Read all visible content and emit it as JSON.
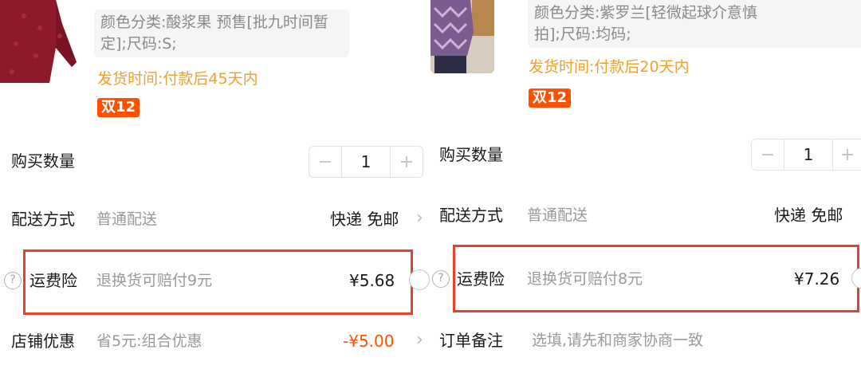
{
  "left": {
    "variant_line1": "颜色分类:酸浆果 预售[批九时间暂",
    "variant_line2": "定];尺码:S;",
    "ship_time": "发货时间:付款后45天内",
    "tag": "双12",
    "quantity": {
      "label": "购买数量",
      "value": "1",
      "minus": "−",
      "plus": "+"
    },
    "delivery": {
      "label": "配送方式",
      "sub": "普通配送",
      "value": "快递 免邮",
      "chevron": "›"
    },
    "insurance": {
      "help": "?",
      "label": "运费险",
      "sub": "退换货可赔付9元",
      "price": "¥5.68"
    },
    "discount": {
      "label": "店铺优惠",
      "sub": "省5元:组合优惠",
      "value": "-¥5.00",
      "chevron": "›"
    }
  },
  "right": {
    "close": "×",
    "variant_line1": "颜色分类:紫罗兰[轻微起球介意慎",
    "variant_line2": "拍];尺码:均码;",
    "ship_time": "发货时间:付款后20天内",
    "tag": "双12",
    "quantity": {
      "label": "购买数量",
      "value": "1",
      "minus": "−",
      "plus": "+"
    },
    "delivery": {
      "label": "配送方式",
      "sub": "普通配送",
      "value": "快递 免邮"
    },
    "insurance": {
      "help": "?",
      "label": "运费险",
      "sub": "退换货可赔付8元",
      "price": "¥7.26"
    },
    "note": {
      "label": "订单备注",
      "placeholder": "选填,请先和商家协商一致"
    }
  },
  "colors": {
    "accent": "#ff5000",
    "ship_time": "#f0a02c",
    "highlight_box": "#e5412c"
  }
}
